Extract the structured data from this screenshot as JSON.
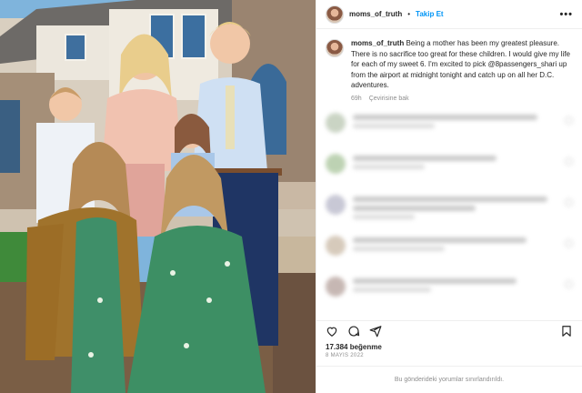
{
  "header": {
    "username": "moms_of_truth",
    "separator": "•",
    "follow_label": "Takip Et",
    "more_label": "•••"
  },
  "caption": {
    "username": "moms_of_truth",
    "text": "Being a mother has been my greatest pleasure. There is no sacrifice too great for these children. I would give my life for each of my sweet 6. I'm excited to pick @8passengers_shari up from the airport at midnight tonight and catch up on all her D.C. adventures.",
    "time": "69h",
    "translate_label": "Çevirisine bak"
  },
  "actions": {
    "icons": [
      "heart-icon",
      "comment-icon",
      "share-icon",
      "bookmark-icon"
    ]
  },
  "likes": "17.384 beğenme",
  "date": "8 MAYIS 2022",
  "comments_limited": "Bu gönderideki yorumlar sınırlandırıldı.",
  "colors": {
    "accent": "#0095f6",
    "text": "#262626",
    "muted": "#8e8e8e",
    "border": "#efefef"
  }
}
